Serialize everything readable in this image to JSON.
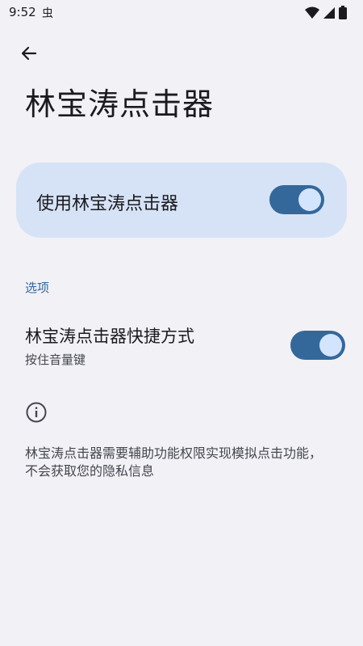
{
  "status_bar": {
    "time": "9:52",
    "bug_glyph": "虫",
    "icons": [
      "wifi-icon",
      "signal-icon",
      "battery-icon"
    ]
  },
  "header": {
    "back_icon": "arrow-back-icon",
    "title": "林宝涛点击器"
  },
  "main_toggle": {
    "label": "使用林宝涛点击器",
    "on": true
  },
  "options": {
    "section_title": "选项",
    "shortcut": {
      "title": "林宝涛点击器快捷方式",
      "subtitle": "按住音量键",
      "on": true
    }
  },
  "info": {
    "icon": "info-icon",
    "text": "林宝涛点击器需要辅助功能权限实现模拟点击功能，不会获取您的隐私信息"
  },
  "colors": {
    "background": "#f2f1f6",
    "card": "#d6e3f7",
    "accent": "#34689a",
    "knob": "#d3e4ff"
  }
}
